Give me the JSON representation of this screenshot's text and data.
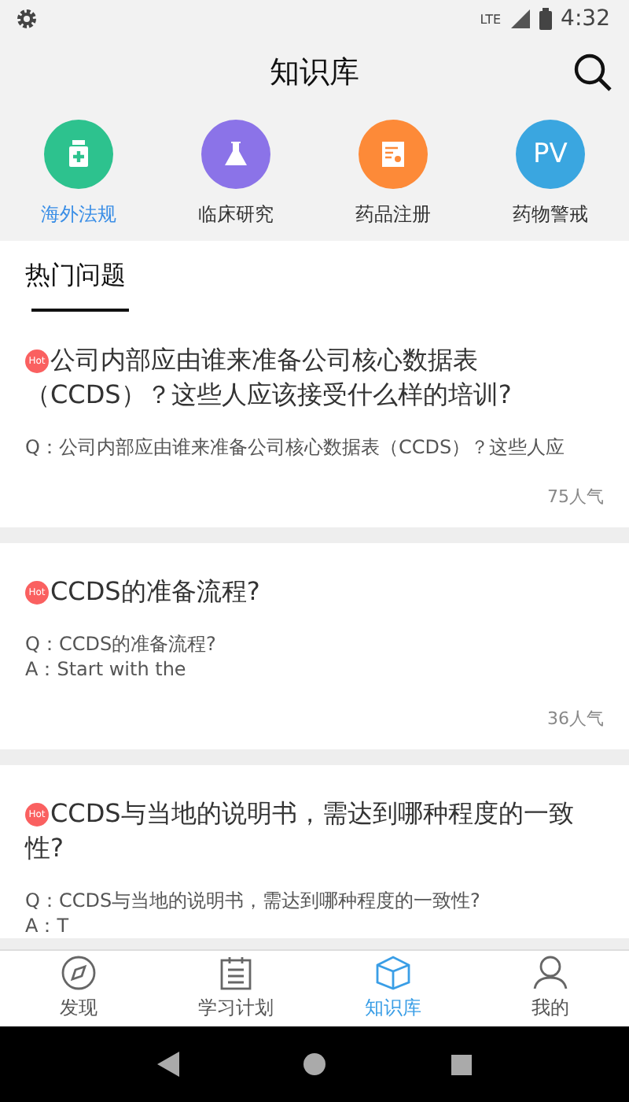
{
  "status_bar": {
    "time": "4:32",
    "network": "LTE"
  },
  "header": {
    "title": "知识库"
  },
  "categories": [
    {
      "kind": "bottle",
      "label": "海外法规",
      "color": "#2dc28e",
      "selected": true
    },
    {
      "kind": "flask",
      "label": "临床研究",
      "color": "#8b73e8",
      "selected": false
    },
    {
      "kind": "certificate",
      "label": "药品注册",
      "color": "#fd8a38",
      "selected": false
    },
    {
      "kind": "text",
      "icon_text": "PV",
      "label": "药物警戒",
      "color": "#3aa6e0",
      "selected": false
    }
  ],
  "section": {
    "title": "热门问题"
  },
  "questions": [
    {
      "badge": "Hot",
      "title": "公司内部应由谁来准备公司核心数据表（CCDS）？这些人应该接受什么样的培训?",
      "lines": [
        "Q：公司内部应由谁来准备公司核心数据表（CCDS）？这些人应"
      ],
      "views": "75人气"
    },
    {
      "badge": "Hot",
      "title": "CCDS的准备流程?",
      "lines": [
        "Q：CCDS的准备流程?",
        "A：Start with the"
      ],
      "views": "36人气"
    },
    {
      "badge": "Hot",
      "title": "CCDS与当地的说明书，需达到哪种程度的一致性?",
      "lines": [
        "Q：CCDS与当地的说明书，需达到哪种程度的一致性?",
        "A：T"
      ]
    }
  ],
  "tab_bar": [
    {
      "kind": "compass",
      "label": "发现",
      "selected": false
    },
    {
      "kind": "calendar",
      "label": "学习计划",
      "selected": false
    },
    {
      "kind": "box",
      "label": "知识库",
      "selected": true
    },
    {
      "kind": "person",
      "label": "我的",
      "selected": false
    }
  ]
}
